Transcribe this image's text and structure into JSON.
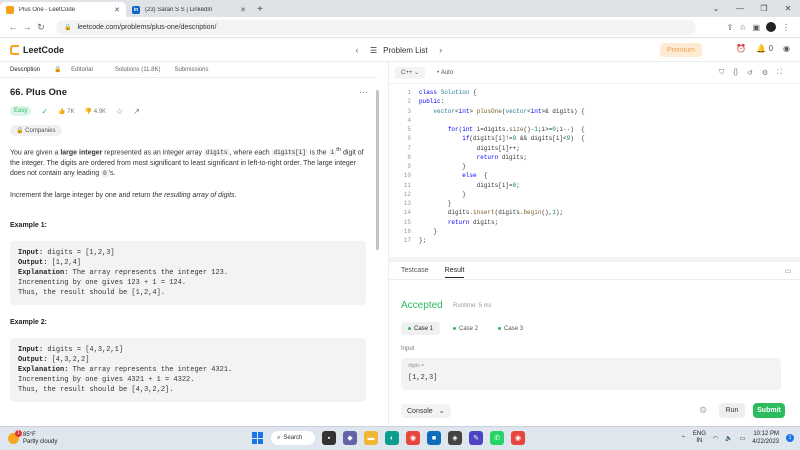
{
  "browser": {
    "tabs": [
      {
        "title": "Plus One - LeetCode",
        "active": true
      },
      {
        "title": "(23) Saran S S | LinkedIn",
        "active": false
      }
    ],
    "url": "leetcode.com/problems/plus-one/description/"
  },
  "lc_nav": {
    "logo_text": "LeetCode",
    "problem_list": "Problem List",
    "premium": "Premium",
    "counter": "0"
  },
  "left": {
    "tabs": [
      "Description",
      "Editorial",
      "Solutions (11.8K)",
      "Submissions"
    ],
    "title": "66. Plus One",
    "difficulty": "Easy",
    "likes": "7K",
    "dislikes": "4.9K",
    "companies": "Companies",
    "desc1_a": "You are given a ",
    "desc1_b": "large integer",
    "desc1_c": " represented as an integer array ",
    "desc1_code1": "digits",
    "desc1_d": ", where each ",
    "desc1_code2": "digits[i]",
    "desc1_e": " is the ",
    "desc1_i": "i",
    "desc1_th": "th",
    "desc1_f": " digit of the integer. The digits are ordered from most significant to least significant in left-to-right order. The large integer does not contain any leading ",
    "desc1_code3": "0",
    "desc1_g": "'s.",
    "desc2_a": "Increment the large integer by one and return ",
    "desc2_b": "the resulting array of digits",
    "desc2_c": ".",
    "examples": [
      {
        "heading": "Example 1:",
        "input_label": "Input:",
        "input": " digits = [1,2,3]",
        "output_label": "Output:",
        "output": " [1,2,4]",
        "expl_label": "Explanation:",
        "expl": " The array represents the integer 123.",
        "line2": "Incrementing by one gives 123 + 1 = 124.",
        "line3": "Thus, the result should be [1,2,4]."
      },
      {
        "heading": "Example 2:",
        "input_label": "Input:",
        "input": " digits = [4,3,2,1]",
        "output_label": "Output:",
        "output": " [4,3,2,2]",
        "expl_label": "Explanation:",
        "expl": " The array represents the integer 4321.",
        "line2": "Incrementing by one gives 4321 + 1 = 4322.",
        "line3": "Thus, the result should be [4,3,2,2]."
      }
    ]
  },
  "editor": {
    "language": "C++",
    "mode": "Auto",
    "line_numbers": [
      "1",
      "2",
      "3",
      "4",
      "5",
      "6",
      "7",
      "8",
      "9",
      "10",
      "11",
      "12",
      "13",
      "14",
      "15",
      "16",
      "17"
    ]
  },
  "result": {
    "tabs": [
      "Testcase",
      "Result"
    ],
    "status": "Accepted",
    "runtime": "Runtime: 5 ms",
    "cases": [
      "Case 1",
      "Case 2",
      "Case 3"
    ],
    "input_label": "Input",
    "var_name": "digits =",
    "var_value": "[1,2,3]",
    "console": "Console",
    "run": "Run",
    "submit": "Submit"
  },
  "taskbar": {
    "temp": "85°F",
    "weather": "Partly cloudy",
    "weather_badge": "1",
    "search": "Search",
    "lang1": "ENG",
    "lang2": "IN",
    "time": "10:12 PM",
    "date": "4/22/2023",
    "notif": "1"
  },
  "colors": {
    "accent_green": "#2cbb5d",
    "leetcode_orange": "#f89f1b",
    "premium": "#f5a05a"
  }
}
